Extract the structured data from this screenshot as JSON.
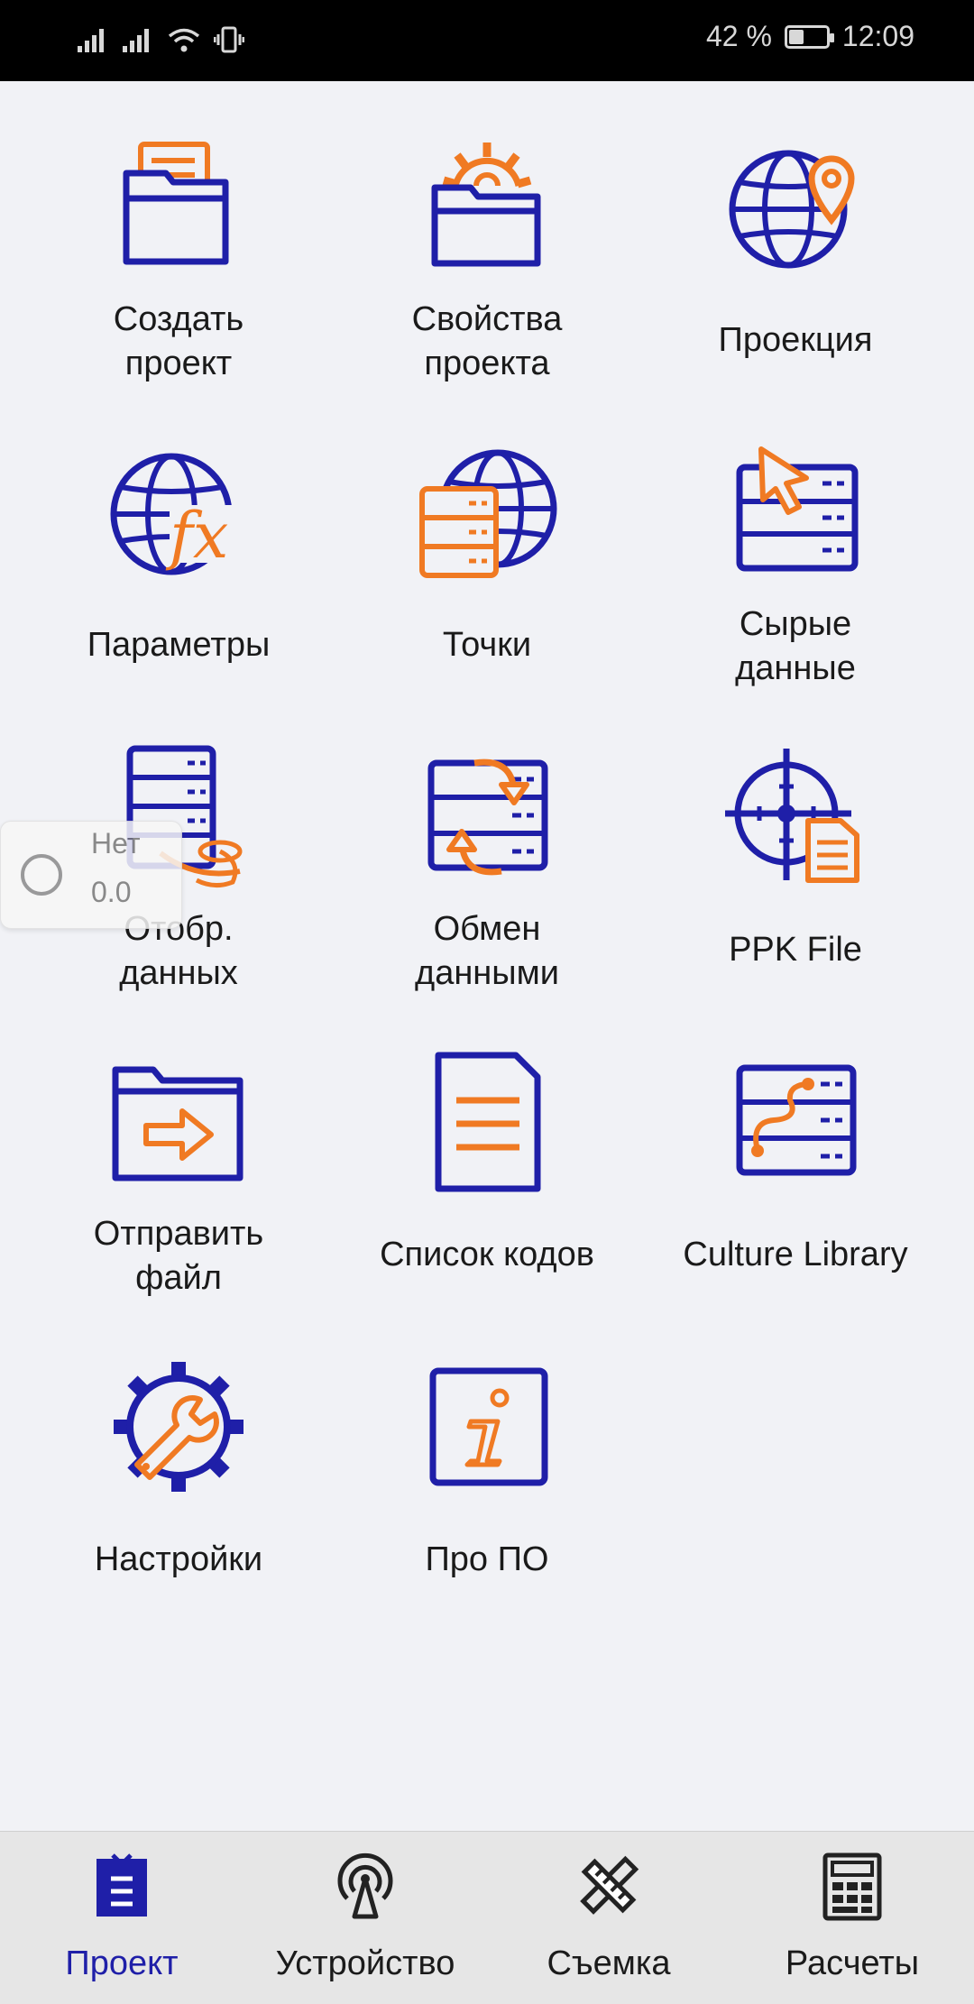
{
  "status_bar": {
    "battery_percent": "42 %",
    "time": "12:09",
    "battery_level": 0.42
  },
  "colors": {
    "brand_blue": "#1f1fa8",
    "accent_orange": "#f07a23",
    "tab_icon": "#222222"
  },
  "grid": {
    "items": [
      {
        "label": "Создать\nпроект",
        "icon": "folder-document-icon"
      },
      {
        "label": "Свойства\nпроекта",
        "icon": "folder-gear-icon"
      },
      {
        "label": "Проекция",
        "icon": "globe-pin-icon"
      },
      {
        "label": "Параметры",
        "icon": "globe-fx-icon"
      },
      {
        "label": "Точки",
        "icon": "globe-database-icon"
      },
      {
        "label": "Сырые\nданные",
        "icon": "database-cursor-icon"
      },
      {
        "label": "Отобр.\nданных",
        "icon": "database-map-icon"
      },
      {
        "label": "Обмен\nданными",
        "icon": "database-exchange-icon"
      },
      {
        "label": "PPK File",
        "icon": "crosshair-document-icon"
      },
      {
        "label": "Отправить\nфайл",
        "icon": "folder-send-icon"
      },
      {
        "label": "Список кодов",
        "icon": "code-list-icon"
      },
      {
        "label": "Culture Library",
        "icon": "database-route-icon"
      },
      {
        "label": "Настройки",
        "icon": "gear-wrench-icon"
      },
      {
        "label": "Про ПО",
        "icon": "info-icon"
      }
    ]
  },
  "overlay": {
    "label": "Нет",
    "value": "0.0"
  },
  "tabbar": {
    "tabs": [
      {
        "label": "Проект",
        "icon": "clipboard-icon",
        "active": true
      },
      {
        "label": "Устройство",
        "icon": "antenna-icon",
        "active": false
      },
      {
        "label": "Съемка",
        "icon": "pencil-ruler-icon",
        "active": false
      },
      {
        "label": "Расчеты",
        "icon": "calculator-icon",
        "active": false
      }
    ]
  }
}
